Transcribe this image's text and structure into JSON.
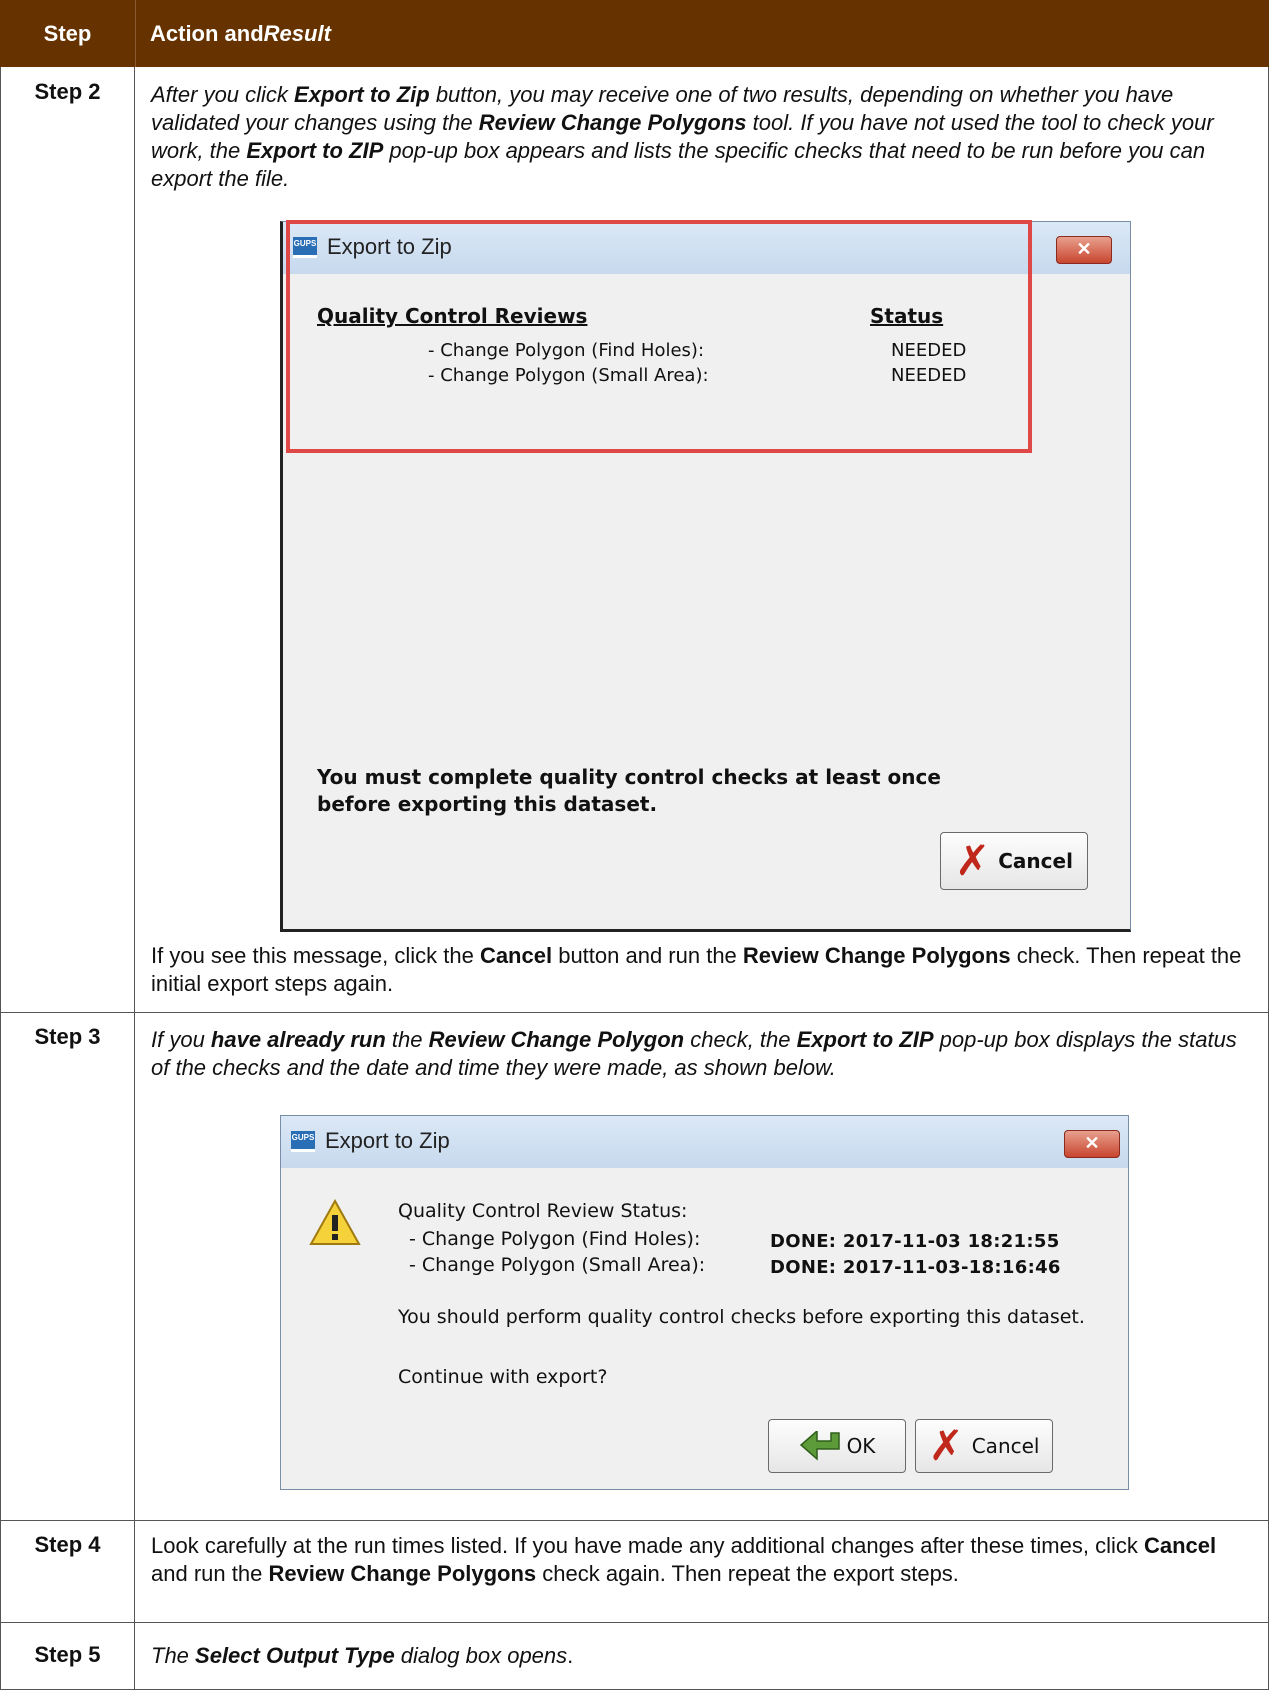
{
  "header": {
    "step": "Step",
    "action_plain": "Action and ",
    "action_italic": "Result"
  },
  "rows": {
    "step2": {
      "label": "Step 2",
      "p1": "After you click ",
      "p1b": "Export to Zip",
      "p2": " button, you may receive one of two results, depending on whether you have validated your changes using the ",
      "p2b": "Review Change Polygons",
      "p3": " tool. If you have not used the tool to check your work, the ",
      "p3b": "Export to ZIP",
      "p4": " pop-up box appears and lists the specific checks that need to be run before you can export the file.",
      "after1": "If you see this message, click the ",
      "after1b": "Cancel",
      "after2": " button and run the ",
      "after2b": "Review Change Polygons",
      "after3": " check. Then repeat the initial export steps again."
    },
    "step3": {
      "label": "Step 3",
      "p1": "If you ",
      "p1b": "have already run",
      "p2": " the ",
      "p2b": "Review Change Polygon",
      "p3": " check, the ",
      "p3b": "Export to ZIP",
      "p4": " pop-up box displays the status of the checks and the date and time they were made, as shown below."
    },
    "step4": {
      "label": "Step 4",
      "p1": "Look carefully at the run times listed. If you have made any additional changes after these times, click ",
      "p1b": "Cancel",
      "p2": " and run the ",
      "p2b": "Review Change Polygons",
      "p3": " check again. Then repeat the export steps."
    },
    "step5": {
      "label": "Step 5",
      "p1": "The ",
      "p1b": "Select Output Type",
      "p2": " dialog box opens",
      "p3": "."
    }
  },
  "dialog1": {
    "app_icon": "GUPS",
    "title": "Export to Zip",
    "close": "✕",
    "col1": "Quality Control Reviews",
    "col2": "Status",
    "items": [
      {
        "name": "- Change Polygon (Find Holes):",
        "status": "NEEDED"
      },
      {
        "name": "- Change Polygon (Small Area):",
        "status": "NEEDED"
      }
    ],
    "message": "You must complete quality control checks at least once before exporting this dataset.",
    "cancel": "Cancel",
    "highlight_color": "#e04848"
  },
  "dialog2": {
    "app_icon": "GUPS",
    "title": "Export to Zip",
    "close": "✕",
    "heading": "Quality Control Review Status:",
    "items": [
      {
        "name": "- Change Polygon (Find Holes):",
        "status": "DONE:  2017-11-03 18:21:55"
      },
      {
        "name": "- Change Polygon (Small Area):",
        "status": "DONE:  2017-11-03-18:16:46"
      }
    ],
    "message": "You should perform quality control checks before exporting this dataset.",
    "question": "Continue with export?",
    "ok": "OK",
    "cancel": "Cancel"
  }
}
